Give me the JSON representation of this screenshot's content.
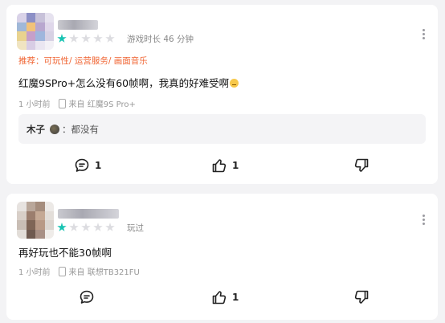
{
  "reviews": [
    {
      "rating": 1,
      "play_time": "游戏时长 46 分钟",
      "tags": "推荐：可玩性/ 运营服务/ 画面音乐",
      "content": "红魔9SPro+怎么没有60帧啊，我真的好难受啊",
      "time": "1 小时前",
      "device": "来自 红魔9S Pro+",
      "reply": {
        "author": "木子",
        "separator": "：",
        "text": "都没有"
      },
      "comment_count": "1",
      "like_count": "1"
    },
    {
      "rating": 1,
      "play_time": "玩过",
      "content": "再好玩也不能30帧啊",
      "time": "1 小时前",
      "device": "来自 联想TB321FU",
      "like_count": "1"
    }
  ],
  "colors": {
    "star_on": "#17c3b2",
    "star_off": "#dcdce0",
    "tags": "#f06432"
  },
  "icons": [
    "comment-icon",
    "thumbs-up-icon",
    "thumbs-down-icon",
    "more-options-icon",
    "phone-icon"
  ]
}
